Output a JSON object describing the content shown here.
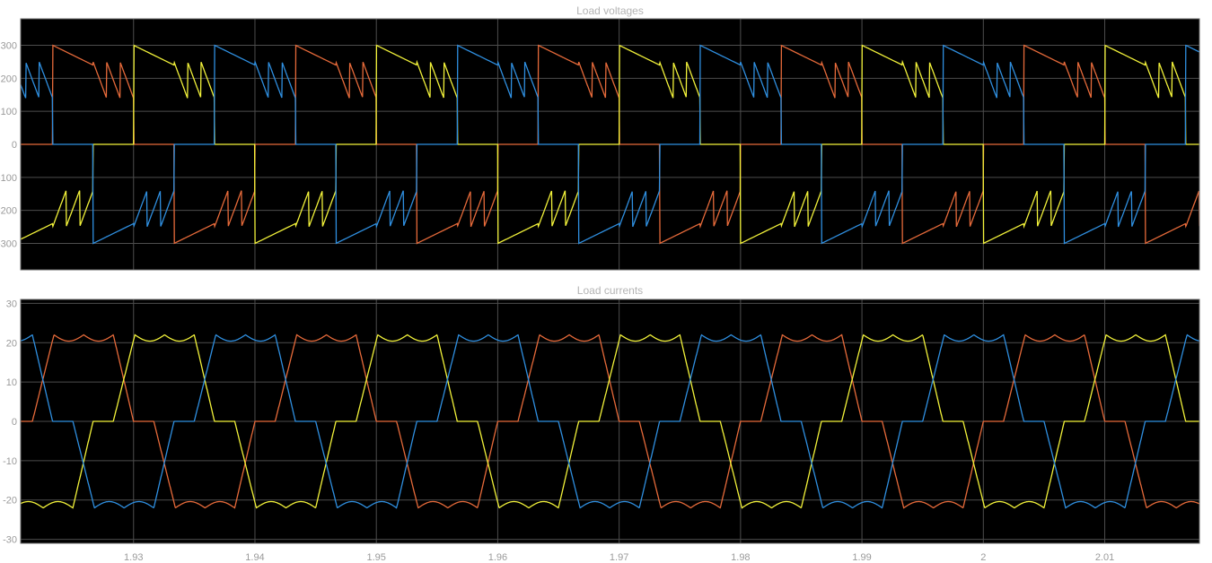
{
  "colors": {
    "page_bg": "#ffffff",
    "plot_bg": "#000000",
    "grid": "#4d4d4d",
    "text": "#9a9a9a",
    "phase_a": "#e66a3a",
    "phase_b": "#f2f23a",
    "phase_c": "#2f8fe0"
  },
  "chart_data": [
    {
      "type": "line",
      "title": "Load voltages",
      "xlim": [
        1.9207,
        2.0178
      ],
      "ylim": [
        -380,
        380
      ],
      "yticks": [
        -300,
        -200,
        -100,
        0,
        100,
        200,
        300
      ],
      "ytick_labels": [
        "-300",
        "-200",
        "-100",
        "0",
        "100",
        "200",
        "300"
      ],
      "xticks": [
        1.93,
        1.94,
        1.95,
        1.96,
        1.97,
        1.98,
        1.99,
        2.0,
        2.01
      ],
      "xtick_labels": [],
      "grid": true,
      "legend": false,
      "waveform": "six-step voltage with sawtooth ripple",
      "fundamental_frequency_hz": 50,
      "series": [
        {
          "color_key": "phase_a",
          "peak_v": 310,
          "plateau_v": [
            250,
            130
          ],
          "phase_shift_deg": 0
        },
        {
          "color_key": "phase_b",
          "peak_v": 310,
          "plateau_v": [
            250,
            130
          ],
          "phase_shift_deg": -120
        },
        {
          "color_key": "phase_c",
          "peak_v": 310,
          "plateau_v": [
            250,
            130
          ],
          "phase_shift_deg": 120
        }
      ]
    },
    {
      "type": "line",
      "title": "Load currents",
      "xlim": [
        1.9207,
        2.0178
      ],
      "ylim": [
        -31,
        31
      ],
      "yticks": [
        -30,
        -20,
        -10,
        0,
        10,
        20,
        30
      ],
      "ytick_labels": [
        "-30",
        "-20",
        "-10",
        "0",
        "10",
        "20",
        "30"
      ],
      "xticks": [
        1.93,
        1.94,
        1.95,
        1.96,
        1.97,
        1.98,
        1.99,
        2.0,
        2.01
      ],
      "xtick_labels": [
        "1.93",
        "1.94",
        "1.95",
        "1.96",
        "1.97",
        "1.98",
        "1.99",
        "2",
        "2.01"
      ],
      "grid": true,
      "legend": false,
      "waveform": "quasi-trapezoidal current with zero dead-band",
      "fundamental_frequency_hz": 50,
      "series": [
        {
          "color_key": "phase_a",
          "amplitude_a": 22,
          "phase_shift_deg": 0
        },
        {
          "color_key": "phase_b",
          "amplitude_a": 22,
          "phase_shift_deg": -120
        },
        {
          "color_key": "phase_c",
          "amplitude_a": 22,
          "phase_shift_deg": 120
        }
      ]
    }
  ]
}
